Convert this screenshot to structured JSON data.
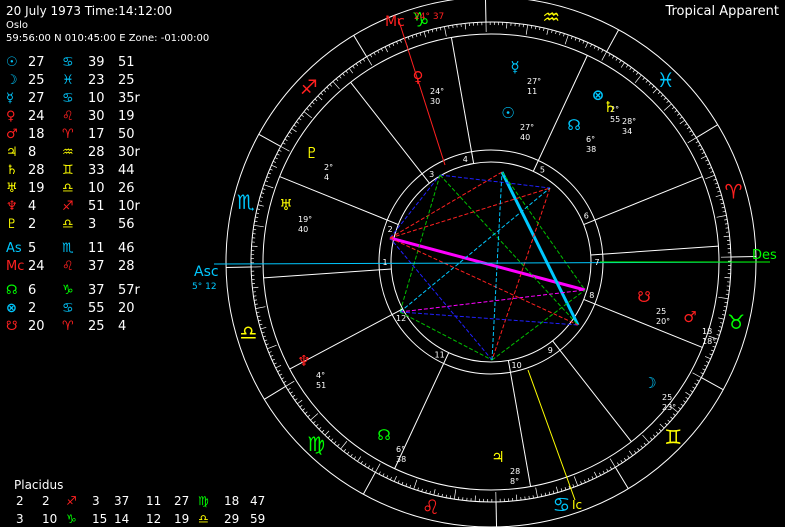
{
  "header": {
    "date_time": "20 July 1973   Time:14:12:00",
    "place": "Oslo",
    "coords": "59:56:00 N 010:45:00 E  Zone: -01:00:00",
    "mode": "Tropical Apparent"
  },
  "positions": [
    {
      "glyph": "☉",
      "color": "#00c8ff",
      "deg": "27",
      "sign": "♋",
      "sign_color": "#00c8ff",
      "min": "39",
      "extra": "51"
    },
    {
      "glyph": "☽",
      "color": "#00c8ff",
      "deg": "25",
      "sign": "♓",
      "sign_color": "#00c8ff",
      "min": "23",
      "extra": "25"
    },
    {
      "glyph": "☿",
      "color": "#00c8ff",
      "deg": "27",
      "sign": "♋",
      "sign_color": "#00c8ff",
      "min": "10",
      "extra": "35r"
    },
    {
      "glyph": "♀",
      "color": "#ff2020",
      "deg": "24",
      "sign": "♌",
      "sign_color": "#ff2020",
      "min": "30",
      "extra": "19"
    },
    {
      "glyph": "♂",
      "color": "#ff2020",
      "deg": "18",
      "sign": "♈",
      "sign_color": "#ff2020",
      "min": "17",
      "extra": "50"
    },
    {
      "glyph": "♃",
      "color": "#ffff00",
      "deg": "8",
      "sign": "♒",
      "sign_color": "#ffff00",
      "min": "28",
      "extra": "30r"
    },
    {
      "glyph": "♄",
      "color": "#ffff00",
      "deg": "28",
      "sign": "♊",
      "sign_color": "#ffff00",
      "min": "33",
      "extra": "44"
    },
    {
      "glyph": "♅",
      "color": "#ffff00",
      "deg": "19",
      "sign": "♎",
      "sign_color": "#ffff00",
      "min": "10",
      "extra": "26"
    },
    {
      "glyph": "♆",
      "color": "#ff2020",
      "deg": "4",
      "sign": "♐",
      "sign_color": "#ff2020",
      "min": "51",
      "extra": "10r"
    },
    {
      "glyph": "♇",
      "color": "#ffff00",
      "deg": "2",
      "sign": "♎",
      "sign_color": "#ffff00",
      "min": "3",
      "extra": "56"
    },
    {
      "glyph": "As",
      "color": "#00c8ff",
      "deg": "5",
      "sign": "♏",
      "sign_color": "#00c8ff",
      "min": "11",
      "extra": "46"
    },
    {
      "glyph": "Mc",
      "color": "#ff2020",
      "deg": "24",
      "sign": "♌",
      "sign_color": "#ff2020",
      "min": "37",
      "extra": "28"
    },
    {
      "glyph": "☊",
      "color": "#00ff00",
      "deg": "6",
      "sign": "♑",
      "sign_color": "#00ff00",
      "min": "37",
      "extra": "57r"
    },
    {
      "glyph": "⊗",
      "color": "#00c8ff",
      "deg": "2",
      "sign": "♋",
      "sign_color": "#00c8ff",
      "min": "55",
      "extra": "20"
    },
    {
      "glyph": "☋",
      "color": "#ff2020",
      "deg": "20",
      "sign": "♈",
      "sign_color": "#ff2020",
      "min": "25",
      "extra": "4"
    }
  ],
  "houses": {
    "title": "Placidus",
    "rows": [
      {
        "h": "2",
        "d1": "2",
        "s1": "♐",
        "s1c": "#ff2020",
        "m1": "3",
        "x1": "37",
        "h2": "11",
        "d2": "27",
        "s2": "♍",
        "s2c": "#00ff00",
        "m2": "18",
        "x2": "47"
      },
      {
        "h": "3",
        "d1": "10",
        "s1": "♑",
        "s1c": "#00ff00",
        "m1": "15",
        "x1": "14",
        "h2": "12",
        "d2": "19",
        "s2": "♎",
        "s2c": "#ffff00",
        "m2": "29",
        "x2": "59"
      }
    ]
  },
  "wheel": {
    "asc_label": "Asc",
    "asc_pos": "5° 12",
    "des_label": "Des",
    "mc_label": "Mc",
    "mc_pos": "24° 37",
    "ic_label": "Ic",
    "signs": [
      {
        "glyph": "♌",
        "color": "#ff2020"
      },
      {
        "glyph": "♋",
        "color": "#00c8ff"
      },
      {
        "glyph": "♊",
        "color": "#ffff00"
      },
      {
        "glyph": "♉",
        "color": "#00ff00"
      },
      {
        "glyph": "♈",
        "color": "#ff2020"
      },
      {
        "glyph": "♓",
        "color": "#00c8ff"
      },
      {
        "glyph": "♒",
        "color": "#ffff00"
      },
      {
        "glyph": "♑",
        "color": "#00ff00"
      },
      {
        "glyph": "♐",
        "color": "#ff2020"
      },
      {
        "glyph": "♏",
        "color": "#00c8ff"
      },
      {
        "glyph": "♎",
        "color": "#ffff00"
      },
      {
        "glyph": "♍",
        "color": "#00ff00"
      }
    ],
    "house_numbers": [
      "1",
      "2",
      "3",
      "4",
      "5",
      "6",
      "7",
      "8",
      "9",
      "10",
      "11",
      "12"
    ],
    "planets": [
      {
        "glyph": "♀",
        "color": "#ff2020",
        "deg": "24°",
        "min": "30"
      },
      {
        "glyph": "☿",
        "color": "#00c8ff",
        "deg": "27°",
        "min": "11"
      },
      {
        "glyph": "☉",
        "color": "#00c8ff",
        "deg": "27°",
        "min": "40"
      },
      {
        "glyph": "☊",
        "color": "#00c8ff",
        "deg": "6°",
        "min": "38"
      },
      {
        "glyph": "⊗",
        "color": "#00c8ff",
        "deg": "2°",
        "min": "55"
      },
      {
        "glyph": "♄",
        "color": "#ffff00",
        "deg": "28°",
        "min": "34"
      },
      {
        "glyph": "♇",
        "color": "#ffff00",
        "deg": "2°",
        "min": "4"
      },
      {
        "glyph": "♅",
        "color": "#ffff00",
        "deg": "19°",
        "min": "40"
      },
      {
        "glyph": "♆",
        "color": "#ff2020",
        "deg": "4°",
        "min": "51"
      },
      {
        "glyph": "☊",
        "color": "#00ff00",
        "deg": "6°",
        "min": "38"
      },
      {
        "glyph": "♃",
        "color": "#ffff00",
        "deg": "28",
        "min": "8°"
      },
      {
        "glyph": "☽",
        "color": "#00c8ff",
        "deg": "25",
        "min": "23°"
      },
      {
        "glyph": "♂",
        "color": "#ff2020",
        "deg": "18",
        "min": "18°"
      },
      {
        "glyph": "☋",
        "color": "#ff2020",
        "deg": "25",
        "min": "20°"
      }
    ]
  }
}
